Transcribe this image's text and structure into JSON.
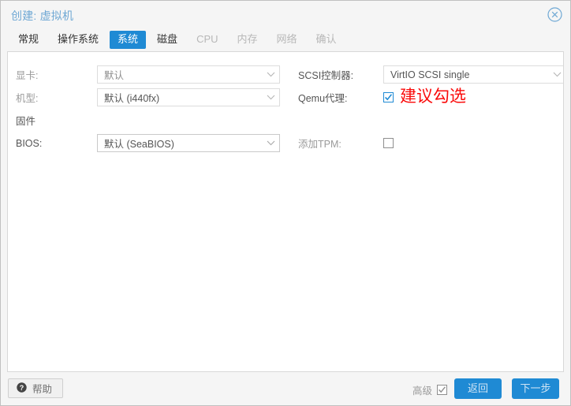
{
  "window": {
    "title": "创建: 虚拟机",
    "close_icon": "close-circle-icon"
  },
  "tabs": [
    {
      "label": "常规",
      "state": "enabled"
    },
    {
      "label": "操作系统",
      "state": "enabled"
    },
    {
      "label": "系统",
      "state": "active"
    },
    {
      "label": "磁盘",
      "state": "enabled"
    },
    {
      "label": "CPU",
      "state": "disabled"
    },
    {
      "label": "内存",
      "state": "disabled"
    },
    {
      "label": "网络",
      "state": "disabled"
    },
    {
      "label": "确认",
      "state": "disabled"
    }
  ],
  "form": {
    "left": {
      "display_label": "显卡:",
      "display_value": "默认",
      "machine_label": "机型:",
      "machine_value": "默认 (i440fx)",
      "firmware_label": "固件",
      "bios_label": "BIOS:",
      "bios_value": "默认 (SeaBIOS)"
    },
    "right": {
      "scsi_label": "SCSI控制器:",
      "scsi_value": "VirtIO SCSI single",
      "qemu_label": "Qemu代理:",
      "qemu_checked": true,
      "tpm_label": "添加TPM:",
      "tpm_checked": false
    }
  },
  "annotation": {
    "text": "建议勾选",
    "color": "#fa0a0a"
  },
  "footer": {
    "help_label": "帮助",
    "help_icon": "question-mark-circle-icon",
    "advanced_label": "高级",
    "advanced_checked": true,
    "back_label": "返回",
    "next_label": "下一步"
  },
  "colors": {
    "accent": "#1f8ad4",
    "title_text": "#6fa8d4",
    "label_gray": "#9a9a9a",
    "annotation_red": "#fa0a0a",
    "window_bg": "#f5f5f5",
    "panel_bg": "#ffffff"
  }
}
